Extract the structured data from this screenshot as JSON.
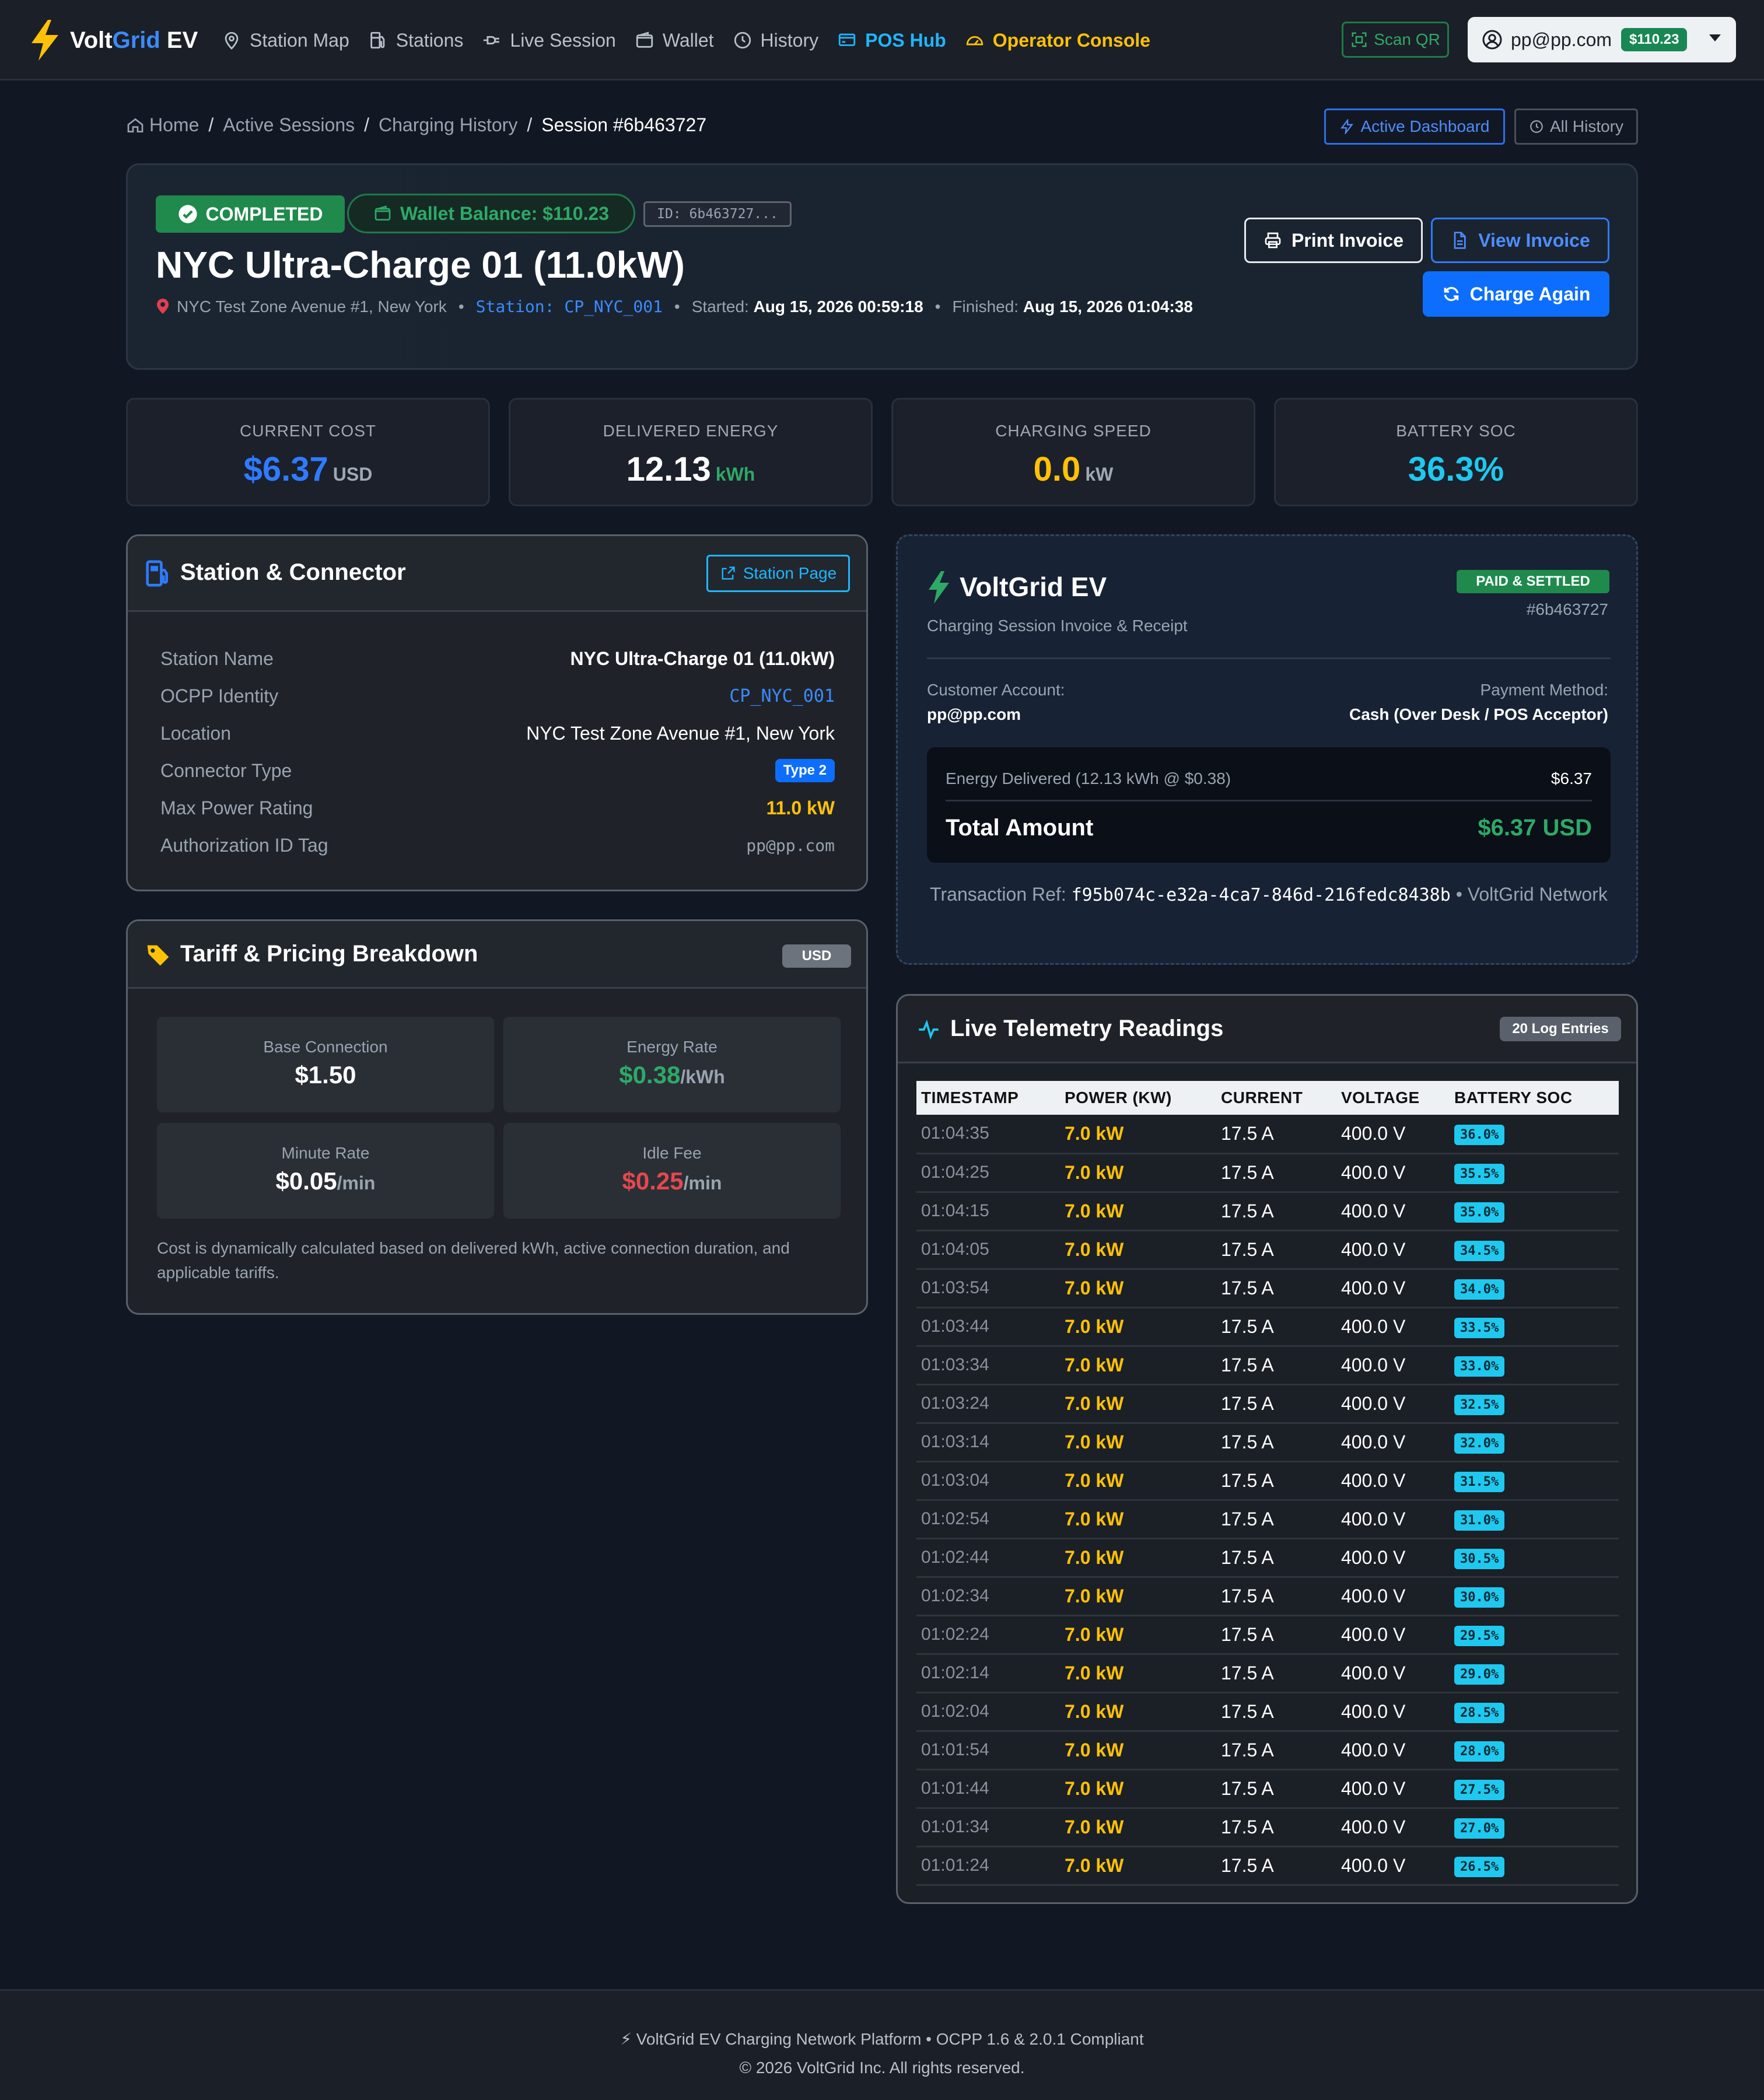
{
  "nav": {
    "brand_volt": "Volt",
    "brand_grid": "Grid",
    "brand_ev": " EV",
    "links": [
      {
        "label": "Station Map",
        "icon": "map-pin-icon"
      },
      {
        "label": "Stations",
        "icon": "fuel-pump-icon"
      },
      {
        "label": "Live Session",
        "icon": "plug-icon"
      },
      {
        "label": "Wallet",
        "icon": "wallet-icon"
      },
      {
        "label": "History",
        "icon": "clock-icon"
      },
      {
        "label": "POS Hub",
        "icon": "pos-terminal-icon"
      },
      {
        "label": "Operator Console",
        "icon": "speedometer-icon"
      }
    ],
    "scan_qr": "Scan QR",
    "user_email": "pp@pp.com",
    "user_balance": "$110.23"
  },
  "breadcrumb": {
    "home": "Home",
    "active_sessions": "Active Sessions",
    "charging_history": "Charging History",
    "current": "Session #6b463727",
    "active_dashboard": "Active Dashboard",
    "all_history": "All History"
  },
  "header": {
    "status": "COMPLETED",
    "wallet_balance": "Wallet Balance: $110.23",
    "session_id": "ID: 6b463727...",
    "title": "NYC Ultra-Charge 01 (11.0kW)",
    "location": "NYC Test Zone Avenue #1, New York",
    "station": "Station: CP_NYC_001",
    "started_label": "Started:",
    "started_value": "Aug 15, 2026 00:59:18",
    "finished_label": "Finished:",
    "finished_value": "Aug 15, 2026 01:04:38",
    "print_invoice": "Print Invoice",
    "view_invoice": "View Invoice",
    "charge_again": "Charge Again"
  },
  "stats": {
    "cost": {
      "label": "CURRENT COST",
      "value": "$6.37",
      "unit": "USD",
      "color": "#2f7bff"
    },
    "energy": {
      "label": "DELIVERED ENERGY",
      "value": "12.13",
      "unit": "kWh",
      "color": "#ffffff"
    },
    "speed": {
      "label": "CHARGING SPEED",
      "value": "0.0",
      "unit": "kW",
      "color": "#ffc107"
    },
    "soc": {
      "label": "BATTERY SOC",
      "value": "36.3%",
      "unit": "",
      "color": "#1fc8ef"
    }
  },
  "station_panel": {
    "title": "Station & Connector",
    "station_page": "Station Page",
    "rows": [
      {
        "key": "Station Name",
        "value": "NYC Ultra-Charge 01 (11.0kW)"
      },
      {
        "key": "OCPP Identity",
        "value": "CP_NYC_001"
      },
      {
        "key": "Location",
        "value": "NYC Test Zone Avenue #1, New York"
      },
      {
        "key": "Connector Type",
        "value": "Type 2"
      },
      {
        "key": "Max Power Rating",
        "value": "11.0 kW"
      },
      {
        "key": "Authorization ID Tag",
        "value": "pp@pp.com"
      }
    ]
  },
  "tariff": {
    "title": "Tariff & Pricing Breakdown",
    "currency": "USD",
    "base_label": "Base Connection",
    "base_value": "$1.50",
    "energy_label": "Energy Rate",
    "energy_value": "$0.38",
    "energy_suffix": "/kWh",
    "minute_label": "Minute Rate",
    "minute_value": "$0.05",
    "minute_suffix": "/min",
    "idle_label": "Idle Fee",
    "idle_value": "$0.25",
    "idle_suffix": "/min",
    "note": "Cost is dynamically calculated based on delivered kWh, active connection duration, and applicable tariffs."
  },
  "invoice": {
    "brand": "VoltGrid EV",
    "subtitle": "Charging Session Invoice & Receipt",
    "status": "PAID & SETTLED",
    "number": "#6b463727",
    "customer_label": "Customer Account:",
    "customer_value": "pp@pp.com",
    "payment_label": "Payment Method:",
    "payment_value": "Cash (Over Desk / POS Acceptor)",
    "line_label": "Energy Delivered (12.13 kWh @ $0.38)",
    "line_value": "$6.37",
    "total_label": "Total Amount",
    "total_value": "$6.37 USD",
    "ref_label": "Transaction Ref:",
    "ref_hash": "f95b074c-e32a-4ca7-846d-216fedc8438b",
    "ref_suffix": "• VoltGrid Network"
  },
  "telemetry": {
    "title": "Live Telemetry Readings",
    "badge": "20 Log Entries",
    "headers": [
      "TIMESTAMP",
      "POWER (KW)",
      "CURRENT",
      "VOLTAGE",
      "BATTERY SOC"
    ],
    "rows": [
      [
        "01:04:35",
        "7.0 kW",
        "17.5 A",
        "400.0 V",
        "36.0%"
      ],
      [
        "01:04:25",
        "7.0 kW",
        "17.5 A",
        "400.0 V",
        "35.5%"
      ],
      [
        "01:04:15",
        "7.0 kW",
        "17.5 A",
        "400.0 V",
        "35.0%"
      ],
      [
        "01:04:05",
        "7.0 kW",
        "17.5 A",
        "400.0 V",
        "34.5%"
      ],
      [
        "01:03:54",
        "7.0 kW",
        "17.5 A",
        "400.0 V",
        "34.0%"
      ],
      [
        "01:03:44",
        "7.0 kW",
        "17.5 A",
        "400.0 V",
        "33.5%"
      ],
      [
        "01:03:34",
        "7.0 kW",
        "17.5 A",
        "400.0 V",
        "33.0%"
      ],
      [
        "01:03:24",
        "7.0 kW",
        "17.5 A",
        "400.0 V",
        "32.5%"
      ],
      [
        "01:03:14",
        "7.0 kW",
        "17.5 A",
        "400.0 V",
        "32.0%"
      ],
      [
        "01:03:04",
        "7.0 kW",
        "17.5 A",
        "400.0 V",
        "31.5%"
      ],
      [
        "01:02:54",
        "7.0 kW",
        "17.5 A",
        "400.0 V",
        "31.0%"
      ],
      [
        "01:02:44",
        "7.0 kW",
        "17.5 A",
        "400.0 V",
        "30.5%"
      ],
      [
        "01:02:34",
        "7.0 kW",
        "17.5 A",
        "400.0 V",
        "30.0%"
      ],
      [
        "01:02:24",
        "7.0 kW",
        "17.5 A",
        "400.0 V",
        "29.5%"
      ],
      [
        "01:02:14",
        "7.0 kW",
        "17.5 A",
        "400.0 V",
        "29.0%"
      ],
      [
        "01:02:04",
        "7.0 kW",
        "17.5 A",
        "400.0 V",
        "28.5%"
      ],
      [
        "01:01:54",
        "7.0 kW",
        "17.5 A",
        "400.0 V",
        "28.0%"
      ],
      [
        "01:01:44",
        "7.0 kW",
        "17.5 A",
        "400.0 V",
        "27.5%"
      ],
      [
        "01:01:34",
        "7.0 kW",
        "17.5 A",
        "400.0 V",
        "27.0%"
      ],
      [
        "01:01:24",
        "7.0 kW",
        "17.5 A",
        "400.0 V",
        "26.5%"
      ]
    ]
  },
  "footer": {
    "line1": "⚡ VoltGrid EV Charging Network Platform • OCPP 1.6 & 2.0.1 Compliant",
    "line2": "© 2026 VoltGrid Inc. All rights reserved."
  }
}
